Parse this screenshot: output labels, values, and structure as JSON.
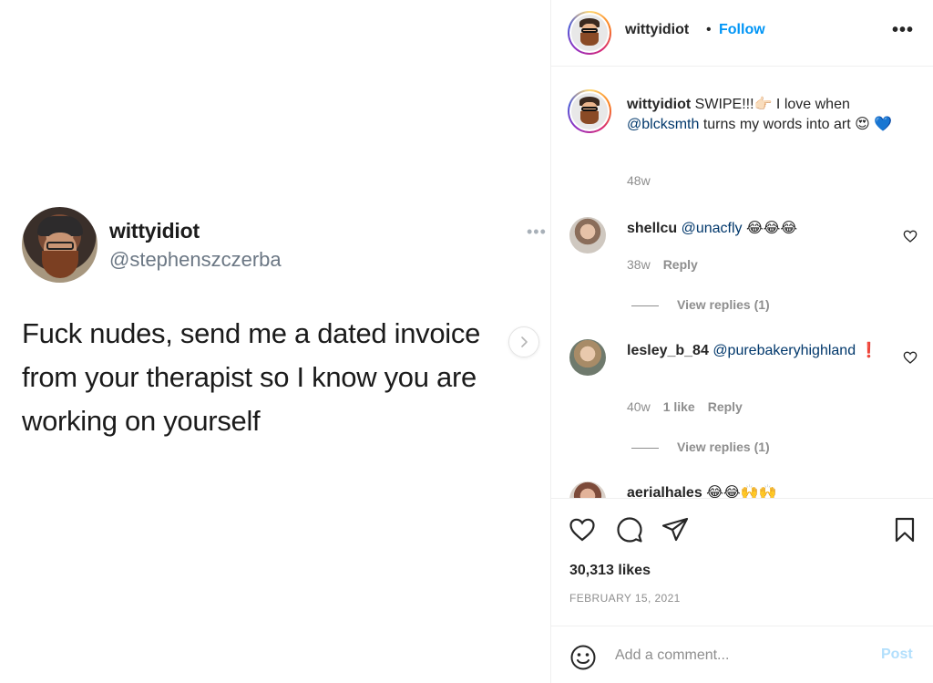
{
  "tweet": {
    "name": "wittyidiot",
    "handle": "@stephenszczerba",
    "more": "•••",
    "text": "Fuck nudes, send me a dated invoice from your therapist so I know you are working on yourself"
  },
  "header": {
    "username": "wittyidiot",
    "separator": "•",
    "follow_label": "Follow",
    "more": "•••"
  },
  "caption": {
    "username": "wittyidiot",
    "text_before": " SWIPE!!!👉🏻 I love when ",
    "mention": "@blcksmth",
    "text_after": " turns my words into art 😍 💙",
    "age": "48w"
  },
  "comments": [
    {
      "username": "shellcu",
      "mention": "@unacfly",
      "text": " 😂😂😂",
      "age": "38w",
      "likes": "",
      "reply_label": "Reply",
      "view_replies": "View replies (1)"
    },
    {
      "username": "lesley_b_84",
      "mention": "@purebakeryhighland",
      "text": " ❗",
      "age": "40w",
      "likes": "1 like",
      "reply_label": "Reply",
      "view_replies": "View replies (1)"
    },
    {
      "username": "aerialhales",
      "mention": "",
      "text": " 😂😂🙌🙌"
    }
  ],
  "actions": {
    "likes": "30,313 likes",
    "date": "FEBRUARY 15, 2021"
  },
  "add_comment": {
    "placeholder": "Add a comment...",
    "post_label": "Post"
  },
  "colors": {
    "link": "#0095f6",
    "mention": "#00376b",
    "muted": "#8e8e8e",
    "post_disabled": "#b2dffc"
  }
}
